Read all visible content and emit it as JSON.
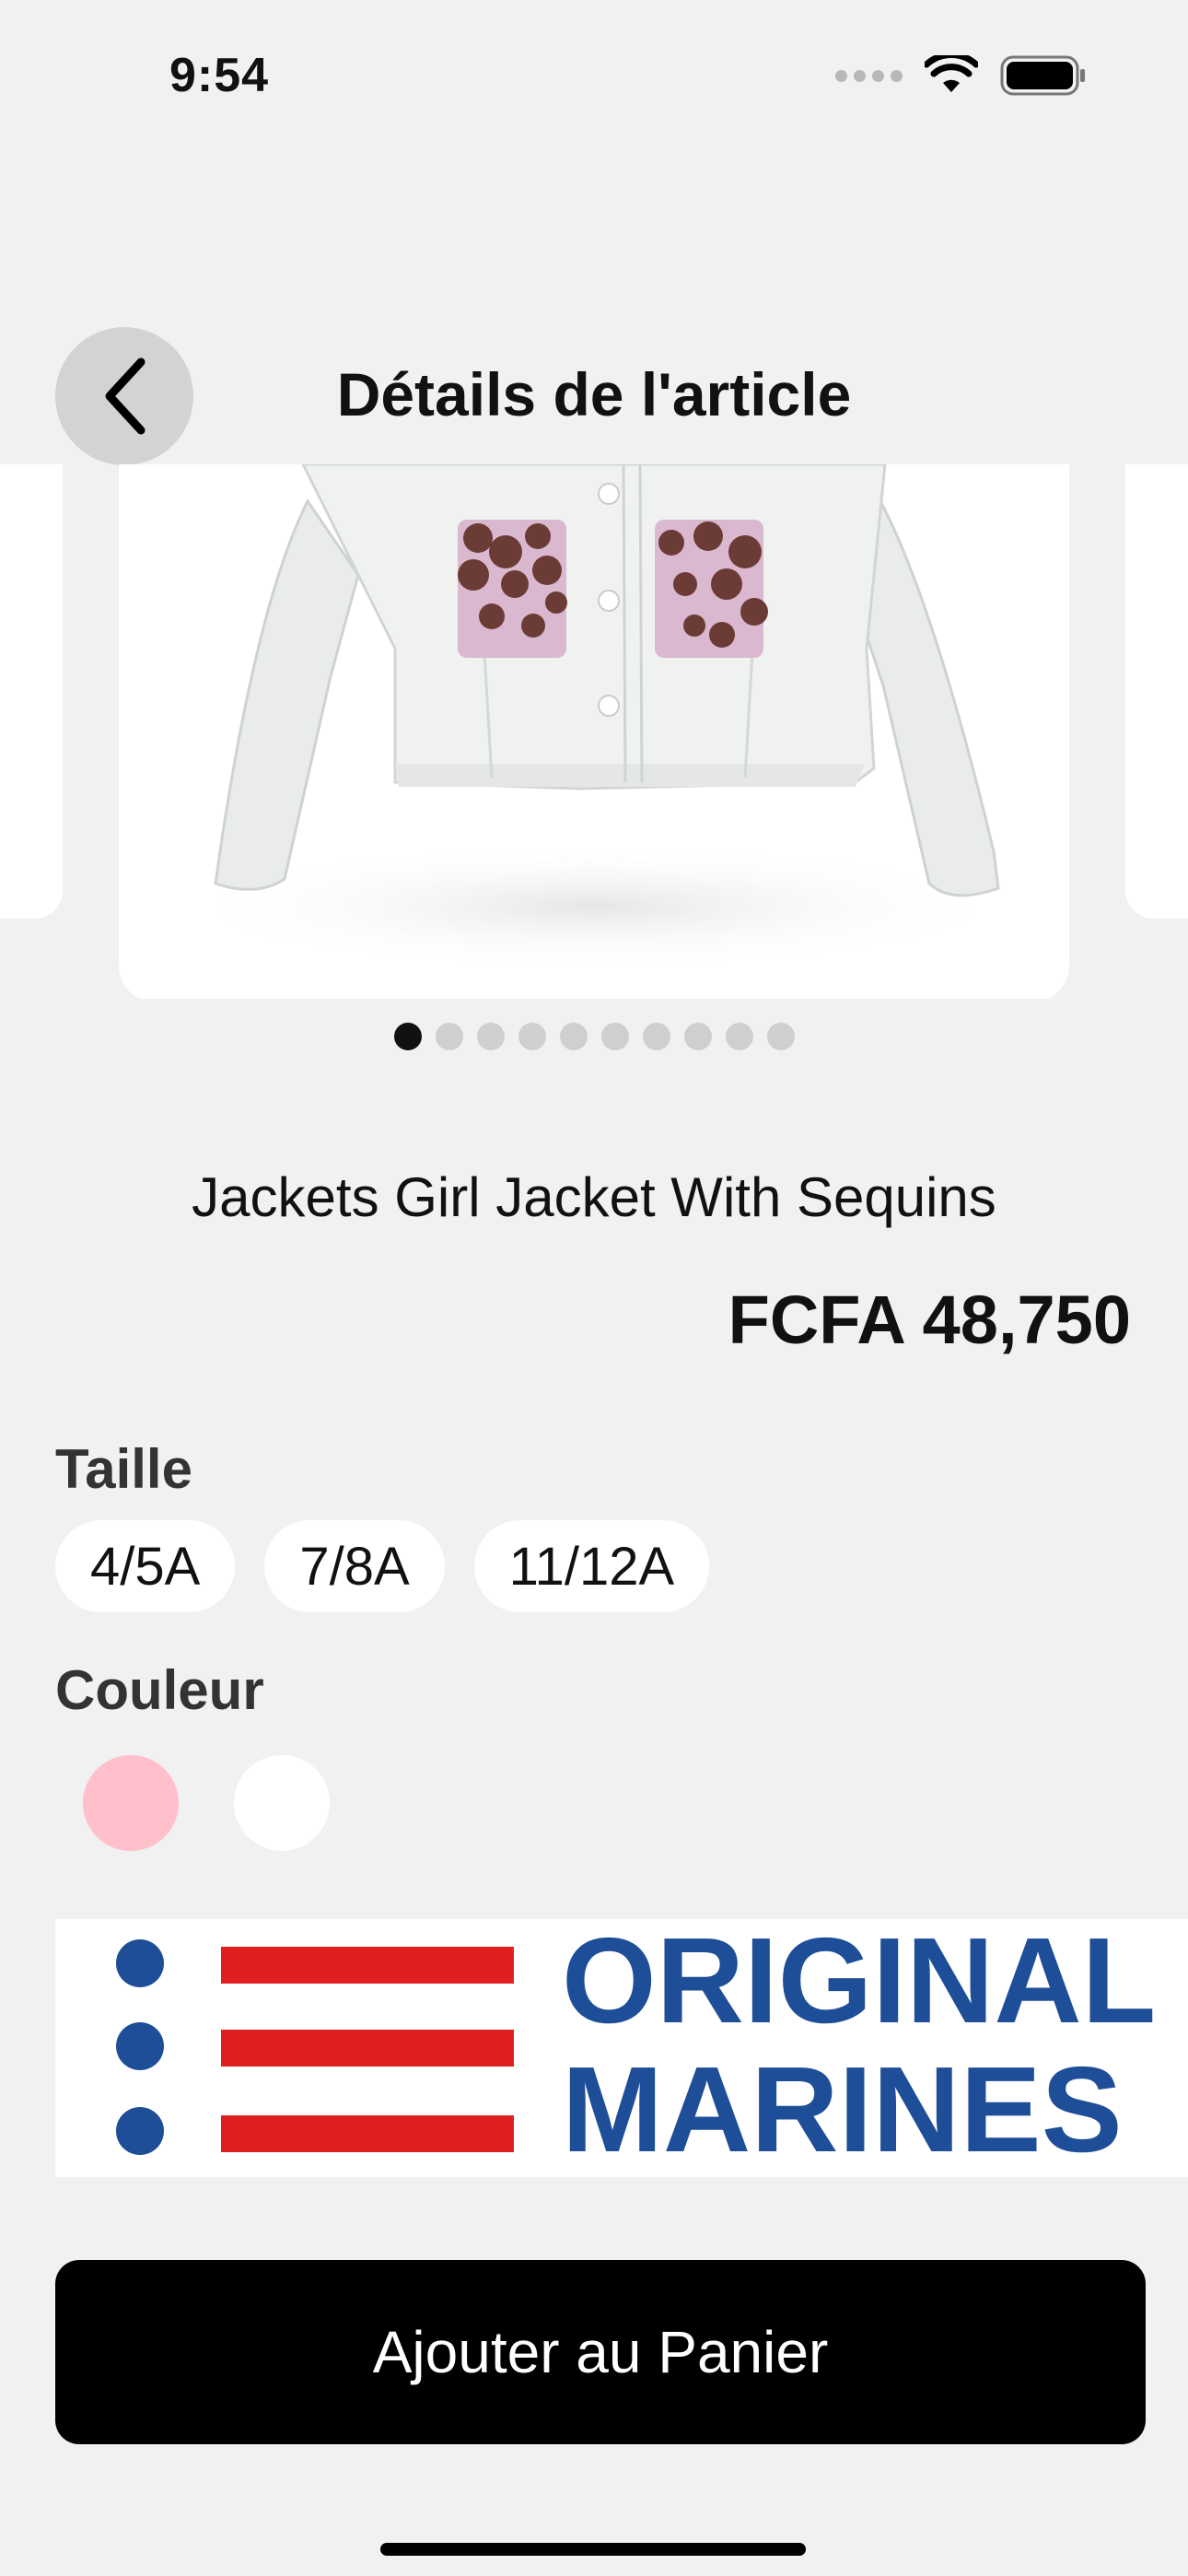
{
  "status_bar": {
    "time": "9:54"
  },
  "header": {
    "title": "Détails de l'article",
    "back_icon": "chevron-left-icon"
  },
  "carousel": {
    "page_count": 10,
    "active_index": 0
  },
  "product": {
    "name": "Jackets Girl Jacket With Sequins",
    "price": "FCFA 48,750"
  },
  "size": {
    "label": "Taille",
    "options": [
      "4/5A",
      "7/8A",
      "11/12A"
    ]
  },
  "color": {
    "label": "Couleur",
    "options": [
      "#ffc0cb",
      "#ffffff"
    ]
  },
  "brand": {
    "line1": "ORIGINAL",
    "line2": "MARINES",
    "navy": "#1e4e98",
    "red": "#e02020"
  },
  "cta": {
    "label": "Ajouter au Panier"
  }
}
